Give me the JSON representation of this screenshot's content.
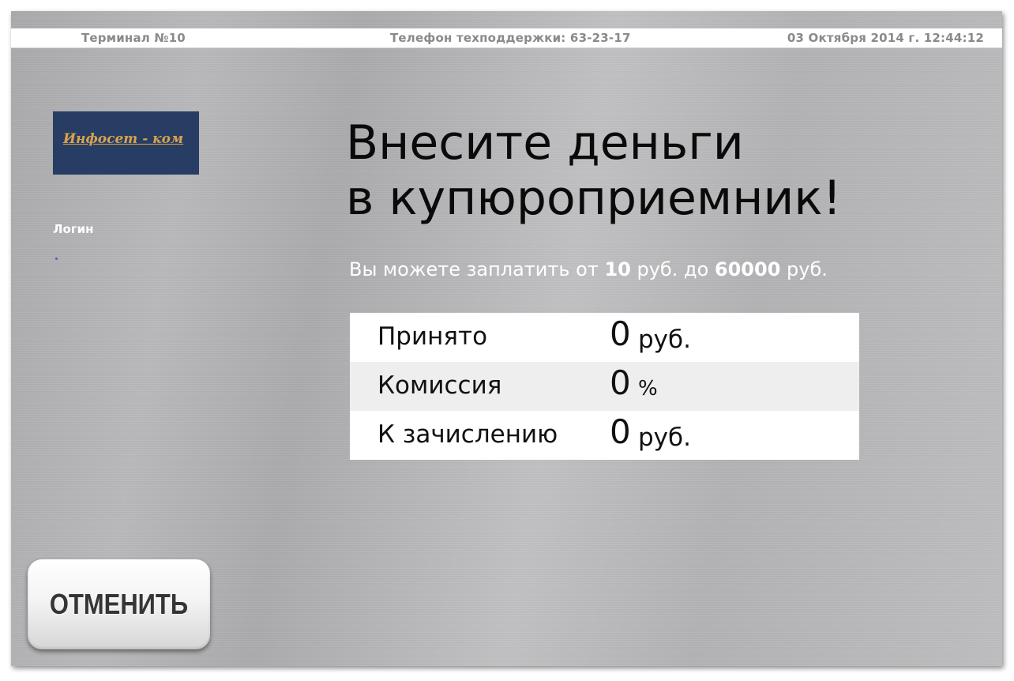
{
  "topbar": {
    "terminal": "Терминал №10",
    "support_phone": "Телефон техподдержки: 63-23-17",
    "datetime": "03 Октября 2014 г. 12:44:12"
  },
  "logo": {
    "label": "Инфосет - ком"
  },
  "login": {
    "label": "Логин"
  },
  "headline": {
    "line1": "Внесите деньги",
    "line2": "в купюроприемник!"
  },
  "limits": {
    "prefix": "Вы можете заплатить от",
    "min": "10",
    "unit1": "руб. до",
    "max": "60000",
    "unit2": "руб."
  },
  "summary": {
    "rows": [
      {
        "label": "Принято",
        "value": "0",
        "unit": "руб."
      },
      {
        "label": "Комиссия",
        "value": "0",
        "unit": "%"
      },
      {
        "label": "К зачислению",
        "value": "0",
        "unit": "руб."
      }
    ]
  },
  "buttons": {
    "cancel_label": "ОТМЕНИТЬ"
  },
  "colors": {
    "logo_bg": "#273d63",
    "logo_text": "#d9a24d",
    "background": "#b6b6b8"
  }
}
